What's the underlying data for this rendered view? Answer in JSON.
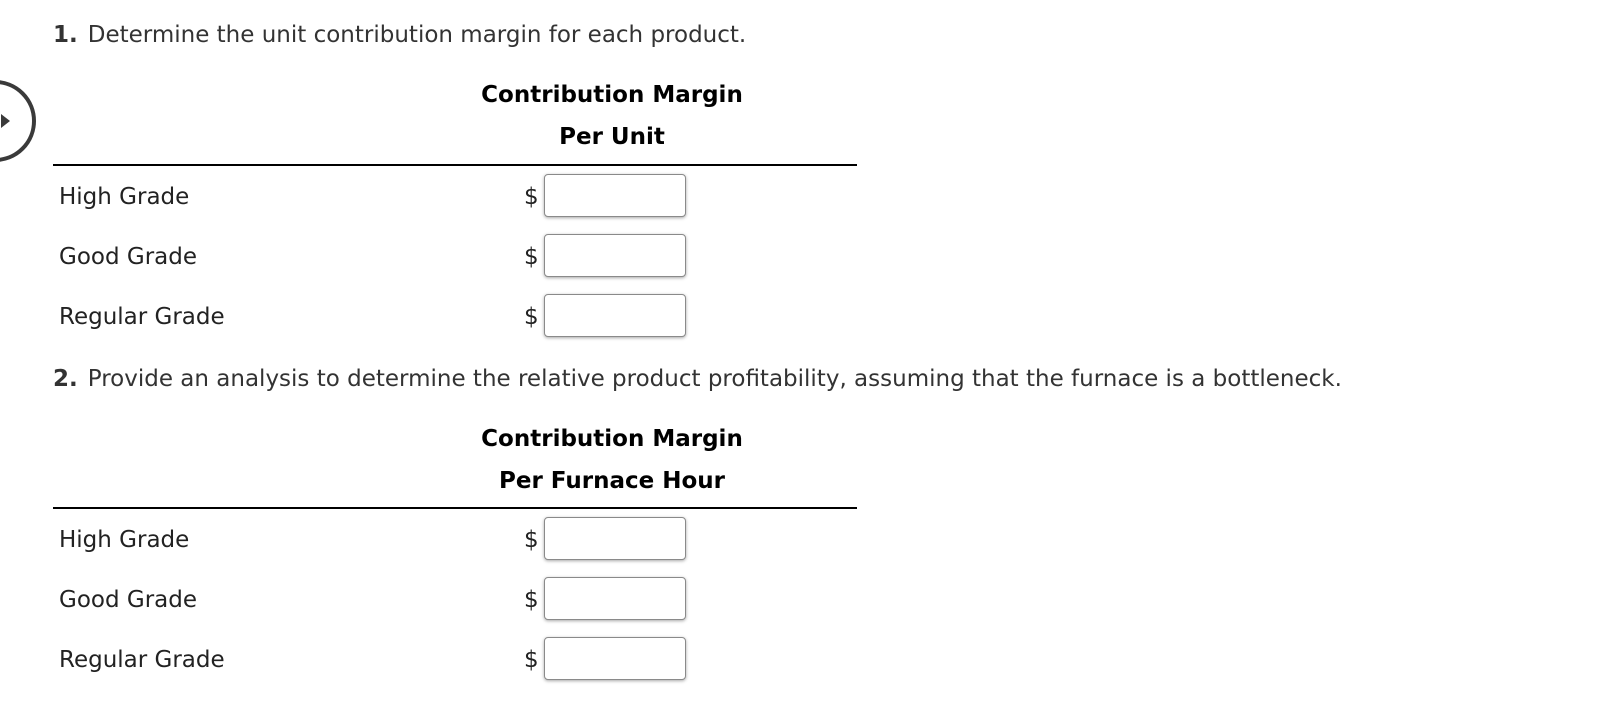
{
  "question1": {
    "number": "1.",
    "text": "Determine the unit contribution margin for each product.",
    "header_line1": "Contribution Margin",
    "header_line2": "Per Unit",
    "currency": "$",
    "rows": [
      {
        "label": "High Grade",
        "value": ""
      },
      {
        "label": "Good Grade",
        "value": ""
      },
      {
        "label": "Regular Grade",
        "value": ""
      }
    ]
  },
  "question2": {
    "number": "2.",
    "text": "Provide an analysis to determine the relative product profitability, assuming that the furnace is a bottleneck.",
    "header_line1": "Contribution Margin",
    "header_line2": "Per Furnace Hour",
    "currency": "$",
    "rows": [
      {
        "label": "High Grade",
        "value": ""
      },
      {
        "label": "Good Grade",
        "value": ""
      },
      {
        "label": "Regular Grade",
        "value": ""
      }
    ]
  }
}
